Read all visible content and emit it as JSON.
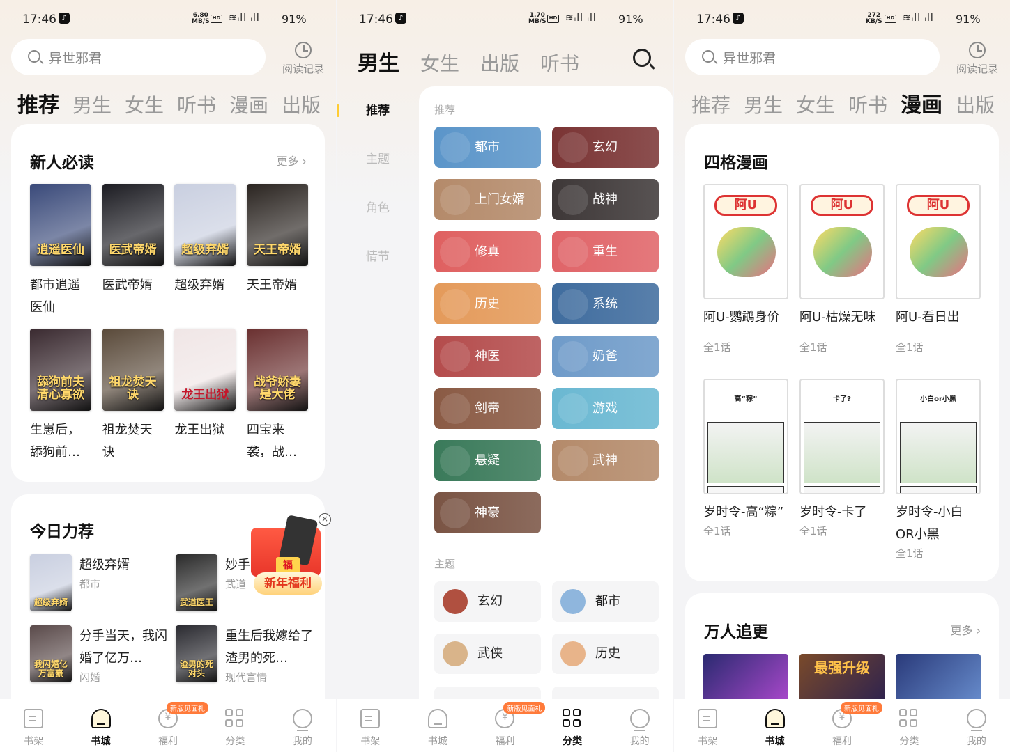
{
  "status": {
    "time": "17:46",
    "net_speed_1": "6.80",
    "net_speed_2": "1.70",
    "net_speed_3": "272",
    "unit_1": "MB/S",
    "unit_2": "MB/S",
    "unit_3": "KB/S",
    "hd": "HD",
    "sig1": "5G",
    "battery": "91%"
  },
  "search": {
    "placeholder": "异世邪君"
  },
  "history_label": "阅读记录",
  "tabs": [
    "推荐",
    "男生",
    "女生",
    "听书",
    "漫画",
    "出版"
  ],
  "home": {
    "section1": {
      "title": "新人必读",
      "more": "更多 ›",
      "books": [
        {
          "name": "都市逍遥医仙",
          "cover_text": "逍遥医仙",
          "bg": "#3a4a7a"
        },
        {
          "name": "医武帝婿",
          "cover_text": "医武帝婿",
          "bg": "#1c1c22"
        },
        {
          "name": "超级弃婿",
          "cover_text": "超级弃婿",
          "bg": "#c9cfe0"
        },
        {
          "name": "天王帝婿",
          "cover_text": "天王帝婿",
          "bg": "#2a2420"
        },
        {
          "name": "生崽后，舔狗前…",
          "cover_text": "舔狗前夫 清心寡欲",
          "bg": "#3a2a30"
        },
        {
          "name": "祖龙焚天诀",
          "cover_text": "祖龙焚天诀",
          "bg": "#5a4a3a"
        },
        {
          "name": "龙王出狱",
          "cover_text": "龙王出狱",
          "bg": "#f0e6e6"
        },
        {
          "name": "四宝来袭，战…",
          "cover_text": "战爷娇妻是大佬",
          "bg": "#6a3030"
        }
      ]
    },
    "section2": {
      "title": "今日力荐",
      "books": [
        {
          "name": "超级弃婿",
          "genre": "都市",
          "cover_text": "超级弃婿",
          "bg": "#c9cfe0"
        },
        {
          "name": "妙手…",
          "genre": "武道",
          "cover_text": "武道医王",
          "bg": "#2a2a2a"
        },
        {
          "name": "分手当天，我闪婚了亿万…",
          "genre": "闪婚",
          "cover_text": "我闪婚亿万富豪",
          "bg": "#5a4a4a"
        },
        {
          "name": "重生后我嫁给了渣男的死…",
          "genre": "现代言情",
          "cover_text": "渣男的死对头",
          "bg": "#2a2a30"
        }
      ]
    },
    "promo": {
      "fu": "福",
      "label": "新年福利",
      "close": "×"
    }
  },
  "category": {
    "tabs": [
      "男生",
      "女生",
      "出版",
      "听书"
    ],
    "side": [
      "推荐",
      "主题",
      "角色",
      "情节"
    ],
    "section_recommend": "推荐",
    "genres": [
      {
        "name": "都市",
        "color": "#5b95c9"
      },
      {
        "name": "玄幻",
        "color": "#7a3434"
      },
      {
        "name": "上门女婿",
        "color": "#b48a6a"
      },
      {
        "name": "战神",
        "color": "#3e3838"
      },
      {
        "name": "修真",
        "color": "#df6060"
      },
      {
        "name": "重生",
        "color": "#e06468"
      },
      {
        "name": "历史",
        "color": "#e49a5a"
      },
      {
        "name": "系统",
        "color": "#3f6c9e"
      },
      {
        "name": "神医",
        "color": "#b44c4c"
      },
      {
        "name": "奶爸",
        "color": "#6f9bc9"
      },
      {
        "name": "剑帝",
        "color": "#8a5a44"
      },
      {
        "name": "游戏",
        "color": "#6ab8d2"
      },
      {
        "name": "悬疑",
        "color": "#3a7a5a"
      },
      {
        "name": "武神",
        "color": "#b48a6a"
      },
      {
        "name": "神豪",
        "color": "#7a5444"
      }
    ],
    "section_theme": "主题",
    "themes": [
      {
        "name": "玄幻",
        "color": "#b05040"
      },
      {
        "name": "都市",
        "color": "#8fb6dd"
      },
      {
        "name": "武侠",
        "color": "#d9b48a"
      },
      {
        "name": "历史",
        "color": "#e8b48a"
      }
    ]
  },
  "comics": {
    "section1": {
      "title": "四格漫画",
      "items": [
        {
          "name": "阿U-鹦鹉身价",
          "ep": "全1话",
          "logo": "阿U"
        },
        {
          "name": "阿U-枯燥无味",
          "ep": "全1话",
          "logo": "阿U"
        },
        {
          "name": "阿U-看日出",
          "ep": "全1话",
          "logo": "阿U"
        },
        {
          "name": "岁时令-高“粽”",
          "ep": "全1话",
          "top": "高“粽”"
        },
        {
          "name": "岁时令-卡了",
          "ep": "全1话",
          "top": "卡了?"
        },
        {
          "name": "岁时令-小白OR小黑",
          "ep": "全1话",
          "top": "小白or小黑"
        }
      ]
    },
    "section2": {
      "title": "万人追更",
      "more": "更多 ›",
      "cover2_text": "最强升级"
    }
  },
  "nav": {
    "items": [
      "书架",
      "书城",
      "福利",
      "分类",
      "我的"
    ],
    "badge": "新版见面礼"
  }
}
